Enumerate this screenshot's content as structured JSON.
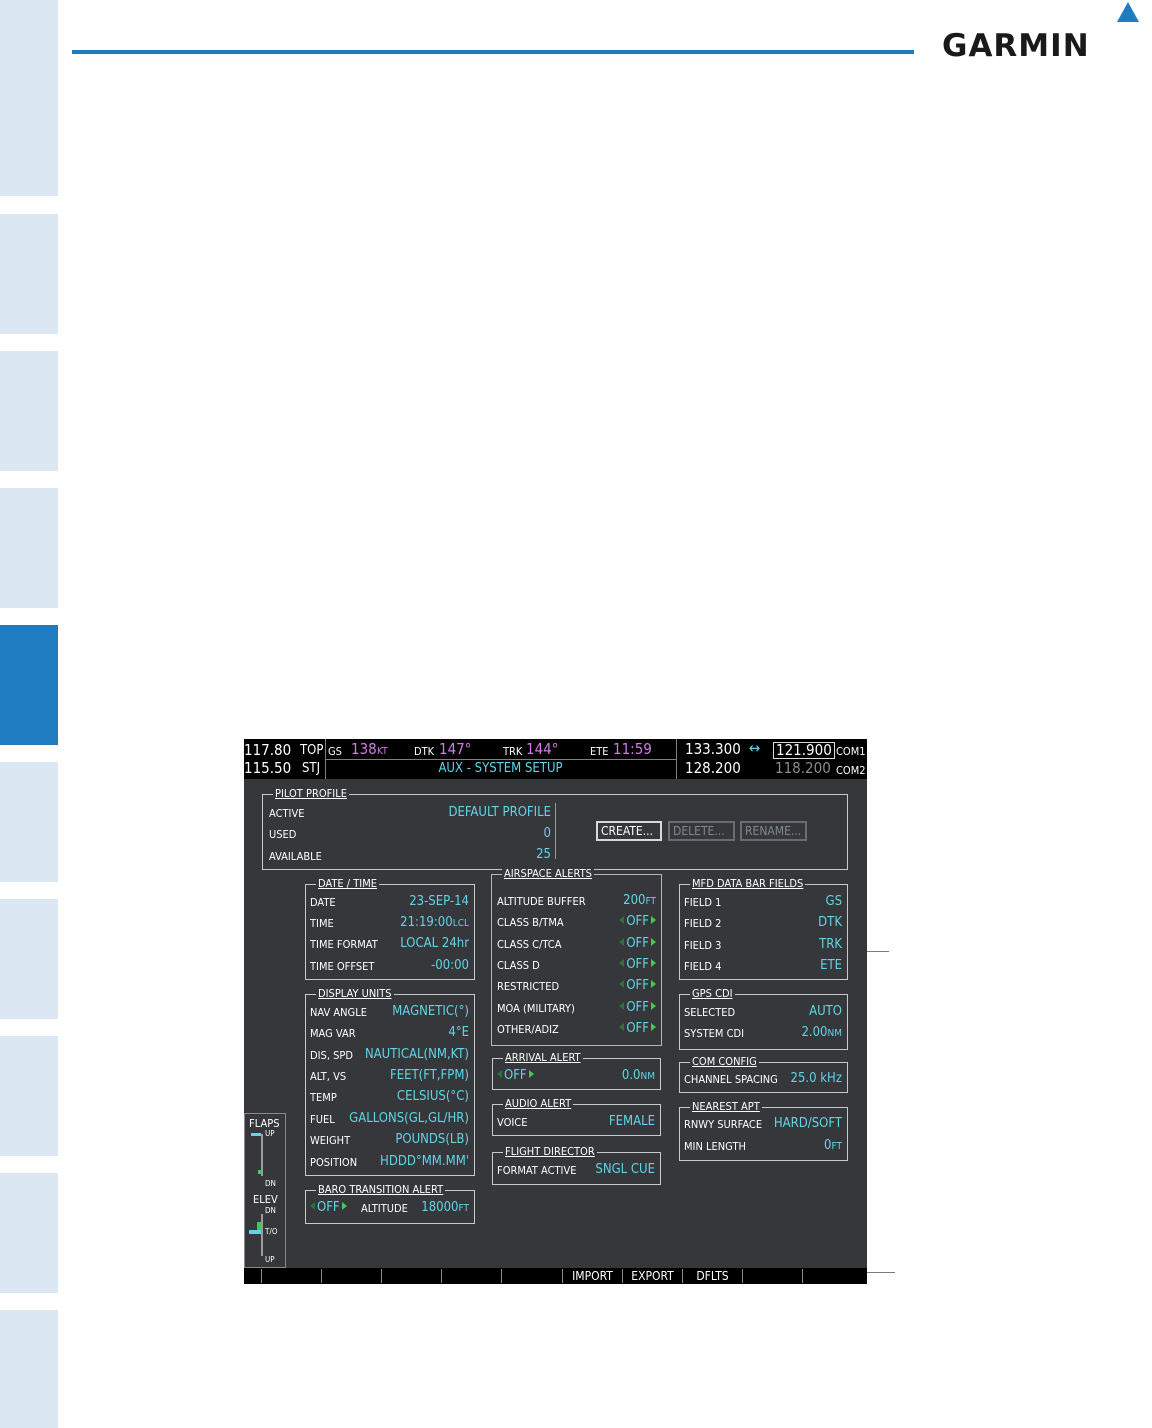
{
  "brand": {
    "logo": "GARMIN"
  },
  "mfd": {
    "nav": {
      "active_freq": "117.80",
      "standby_freq": "115.50",
      "active_id": "TOP",
      "standby_id": "STJ"
    },
    "databar": {
      "gs_label": "GS",
      "gs_value": "138",
      "gs_unit": "KT",
      "dtk_label": "DTK",
      "dtk_value": "147°",
      "trk_label": "TRK",
      "trk_value": "144°",
      "ete_label": "ETE",
      "ete_value": "11:59",
      "page_title": "AUX - SYSTEM SETUP"
    },
    "com": {
      "com1_standby": "133.300",
      "swap": "↔",
      "com1_active": "121.900",
      "com1_label": "COM1",
      "com2_standby": "128.200",
      "com2_active": "118.200",
      "com2_label": "COM2"
    },
    "pilot_profile": {
      "title": "PILOT PROFILE",
      "rows": [
        {
          "label": "ACTIVE",
          "value": "DEFAULT PROFILE"
        },
        {
          "label": "USED",
          "value": "0"
        },
        {
          "label": "AVAILABLE",
          "value": "25"
        }
      ],
      "buttons": {
        "create": "CREATE...",
        "delete": "DELETE...",
        "rename": "RENAME..."
      }
    },
    "date_time": {
      "title": "DATE / TIME",
      "rows": [
        {
          "label": "DATE",
          "value": "23-SEP-14"
        },
        {
          "label": "TIME",
          "value": "21:19:00",
          "unit": "LCL"
        },
        {
          "label": "TIME FORMAT",
          "value": "LOCAL 24hr"
        },
        {
          "label": "TIME OFFSET",
          "value": "-00:00"
        }
      ]
    },
    "display_units": {
      "title": "DISPLAY UNITS",
      "rows": [
        {
          "label": "NAV ANGLE",
          "value": "MAGNETIC(°)"
        },
        {
          "label": "MAG VAR",
          "value": "4°E"
        },
        {
          "label": "DIS, SPD",
          "value": "NAUTICAL(NM,KT)"
        },
        {
          "label": "ALT, VS",
          "value": "FEET(FT,FPM)"
        },
        {
          "label": "TEMP",
          "value": "CELSIUS(°C)"
        },
        {
          "label": "FUEL",
          "value": "GALLONS(GL,GL/HR)"
        },
        {
          "label": "WEIGHT",
          "value": "POUNDS(LB)"
        },
        {
          "label": "POSITION",
          "value": "HDDD°MM.MM'"
        }
      ]
    },
    "baro": {
      "title": "BARO TRANSITION ALERT",
      "state": "OFF",
      "alt_label": "ALTITUDE",
      "alt_value": "18000",
      "alt_unit": "FT"
    },
    "airspace": {
      "title": "AIRSPACE ALERTS",
      "buffer_label": "ALTITUDE BUFFER",
      "buffer_value": "200",
      "buffer_unit": "FT",
      "rows": [
        {
          "label": "CLASS B/TMA",
          "value": "OFF"
        },
        {
          "label": "CLASS C/TCA",
          "value": "OFF"
        },
        {
          "label": "CLASS D",
          "value": "OFF"
        },
        {
          "label": "RESTRICTED",
          "value": "OFF"
        },
        {
          "label": "MOA (MILITARY)",
          "value": "OFF"
        },
        {
          "label": "OTHER/ADIZ",
          "value": "OFF"
        }
      ]
    },
    "arrival": {
      "title": "ARRIVAL ALERT",
      "state": "OFF",
      "value": "0.0",
      "unit": "NM"
    },
    "audio": {
      "title": "AUDIO ALERT",
      "label": "VOICE",
      "value": "FEMALE"
    },
    "flight_director": {
      "title": "FLIGHT DIRECTOR",
      "label": "FORMAT ACTIVE",
      "value": "SNGL CUE"
    },
    "mfd_fields": {
      "title": "MFD DATA BAR FIELDS",
      "rows": [
        {
          "label": "FIELD 1",
          "value": "GS"
        },
        {
          "label": "FIELD 2",
          "value": "DTK"
        },
        {
          "label": "FIELD 3",
          "value": "TRK"
        },
        {
          "label": "FIELD 4",
          "value": "ETE"
        }
      ]
    },
    "gps_cdi": {
      "title": "GPS CDI",
      "rows": [
        {
          "label": "SELECTED",
          "value": "AUTO"
        },
        {
          "label": "SYSTEM CDI",
          "value": "2.00",
          "unit": "NM"
        }
      ]
    },
    "com_config": {
      "title": "COM CONFIG",
      "label": "CHANNEL SPACING",
      "value": "25.0 kHz"
    },
    "nearest_apt": {
      "title": "NEAREST APT",
      "rows": [
        {
          "label": "RNWY SURFACE",
          "value": "HARD/SOFT"
        },
        {
          "label": "MIN LENGTH",
          "value": "0",
          "unit": "FT"
        }
      ]
    },
    "flaps": {
      "flaps_label": "FLAPS",
      "up": "UP",
      "dn": "DN",
      "elev_label": "ELEV",
      "elev_dn": "DN",
      "to": "T/O",
      "elev_up": "UP"
    },
    "softkeys": {
      "import": "IMPORT",
      "export": "EXPORT",
      "dflts": "DFLTS"
    }
  }
}
